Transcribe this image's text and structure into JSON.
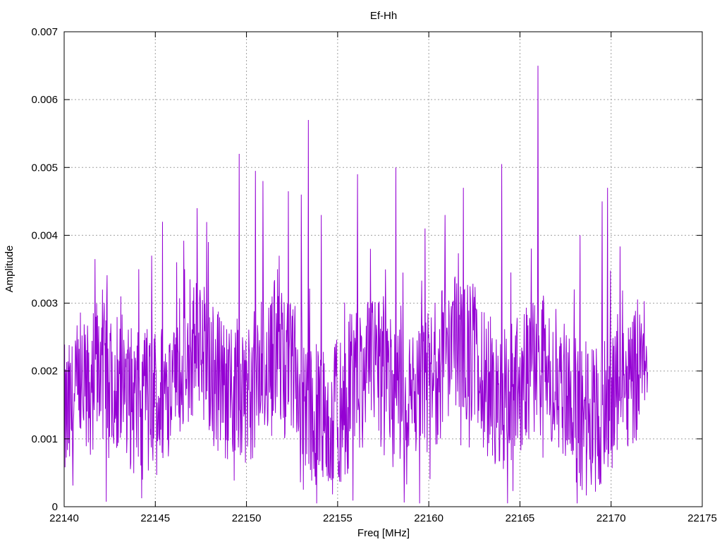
{
  "chart_data": {
    "type": "line",
    "title": "Ef-Hh",
    "xlabel": "Freq [MHz]",
    "ylabel": "Amplitude",
    "xlim": [
      22140,
      22175
    ],
    "ylim": [
      0,
      0.007
    ],
    "x_ticks": [
      "22140",
      "22145",
      "22150",
      "22155",
      "22160",
      "22165",
      "22170",
      "22175"
    ],
    "y_ticks": [
      "0",
      "0.001",
      "0.002",
      "0.003",
      "0.004",
      "0.005",
      "0.006",
      "0.007"
    ],
    "grid": true,
    "legend": "none",
    "series": [
      {
        "color": "#9400d3",
        "x_range": [
          22140,
          22172
        ],
        "baseline_level": 0.0018,
        "peaks": [
          {
            "x": 22141.7,
            "y": 0.00365
          },
          {
            "x": 22142.1,
            "y": 0.0032
          },
          {
            "x": 22143.1,
            "y": 0.0031
          },
          {
            "x": 22144.1,
            "y": 0.0035
          },
          {
            "x": 22144.8,
            "y": 0.0037
          },
          {
            "x": 22145.4,
            "y": 0.0042
          },
          {
            "x": 22146.6,
            "y": 0.0035
          },
          {
            "x": 22147.3,
            "y": 0.0044
          },
          {
            "x": 22147.9,
            "y": 0.0039
          },
          {
            "x": 22149.6,
            "y": 0.0052
          },
          {
            "x": 22150.5,
            "y": 0.00495
          },
          {
            "x": 22150.9,
            "y": 0.0048
          },
          {
            "x": 22151.7,
            "y": 0.0035
          },
          {
            "x": 22152.3,
            "y": 0.00465
          },
          {
            "x": 22153.0,
            "y": 0.0046
          },
          {
            "x": 22153.4,
            "y": 0.0057
          },
          {
            "x": 22154.1,
            "y": 0.0043
          },
          {
            "x": 22156.1,
            "y": 0.0049
          },
          {
            "x": 22156.8,
            "y": 0.0038
          },
          {
            "x": 22158.2,
            "y": 0.005
          },
          {
            "x": 22159.8,
            "y": 0.0041
          },
          {
            "x": 22160.9,
            "y": 0.0043
          },
          {
            "x": 22161.9,
            "y": 0.0047
          },
          {
            "x": 22164.0,
            "y": 0.00505
          },
          {
            "x": 22166.0,
            "y": 0.0065
          },
          {
            "x": 22168.3,
            "y": 0.004
          },
          {
            "x": 22169.5,
            "y": 0.0045
          },
          {
            "x": 22169.8,
            "y": 0.0047
          },
          {
            "x": 22171.6,
            "y": 0.0025
          }
        ]
      }
    ]
  }
}
